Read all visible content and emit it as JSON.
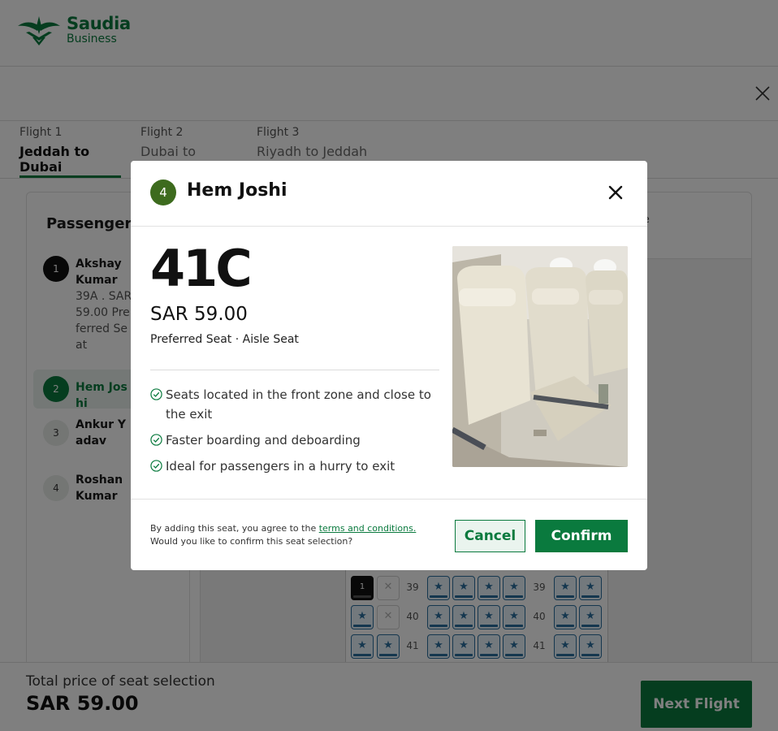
{
  "brand": {
    "name": "Saudia",
    "sub": "Business",
    "color": "#0a7a3e"
  },
  "tabs": [
    {
      "small": "Flight 1",
      "label": "Jeddah to Dubai",
      "active": true
    },
    {
      "small": "Flight 2",
      "label": "Dubai to Riyadh",
      "active": false
    },
    {
      "small": "Flight 3",
      "label": "Riyadh to Jeddah",
      "active": false
    }
  ],
  "passengers": {
    "title": "Passengers",
    "items": [
      {
        "num": "1",
        "name": "Akshay Kumar",
        "detail": "39A . SAR 59.00 Preferred Seat"
      },
      {
        "num": "2",
        "name": "Hem Joshi",
        "detail": ""
      },
      {
        "num": "3",
        "name": "Ankur Yadav",
        "detail": ""
      },
      {
        "num": "4",
        "name": "Roshan Kumar",
        "detail": ""
      }
    ]
  },
  "seatmap": {
    "legend": "le",
    "rows": [
      "39",
      "40",
      "41"
    ],
    "taken_label": "1"
  },
  "footer": {
    "total_label": "Total price of seat selection",
    "total_price": "SAR 59.00",
    "next_label": "Next Flight"
  },
  "modal": {
    "badge": "4",
    "name": "Hem Joshi",
    "seat_code": "41C",
    "price": "SAR 59.00",
    "seat_type": "Preferred Seat · Aisle Seat",
    "features": [
      "Seats located in the front zone and close to the exit",
      "Faster boarding and deboarding",
      "Ideal for passengers in a hurry to exit"
    ],
    "terms_prefix": "By adding this seat, you agree to the ",
    "terms_link": "terms and conditions.",
    "terms_question": "Would you like to confirm this seat selection?",
    "cancel_label": "Cancel",
    "confirm_label": "Confirm"
  }
}
